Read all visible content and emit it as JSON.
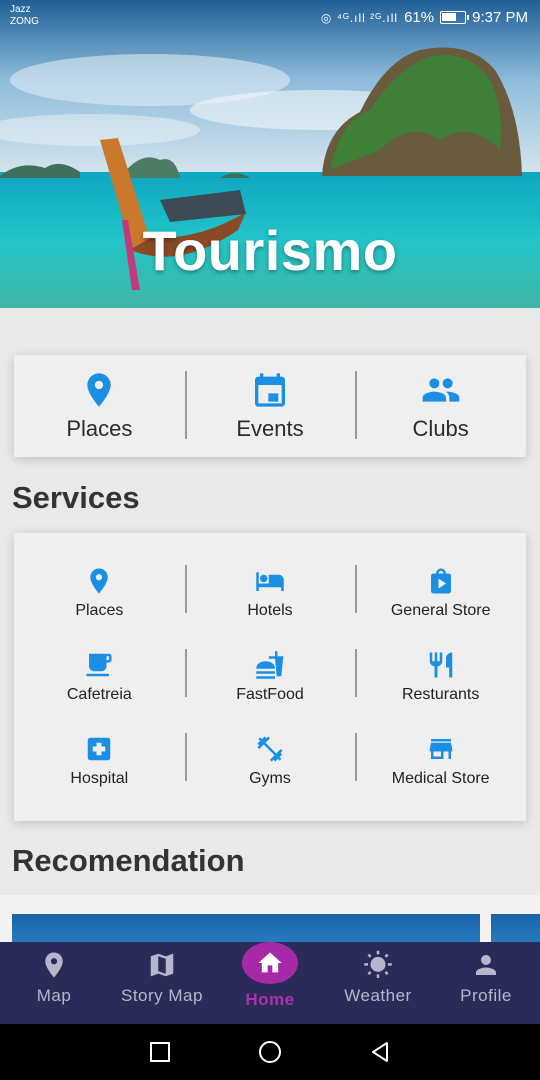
{
  "status_bar": {
    "carrier_1": "Jazz",
    "carrier_2": "ZONG",
    "signal_glyphs": "◎ ⁴ᴳ.ıll ²ᴳ.ıll",
    "battery": "61%",
    "time": "9:37 PM"
  },
  "hero": {
    "title": "Tourismo"
  },
  "quick_links": [
    {
      "label": "Places",
      "icon": "map-pin-icon"
    },
    {
      "label": "Events",
      "icon": "calendar-icon"
    },
    {
      "label": "Clubs",
      "icon": "group-icon"
    }
  ],
  "services": {
    "title": "Services",
    "items": [
      {
        "label": "Places",
        "icon": "map-pin-icon"
      },
      {
        "label": "Hotels",
        "icon": "bed-icon"
      },
      {
        "label": "General Store",
        "icon": "shopping-bag-icon"
      },
      {
        "label": "Cafetreia",
        "icon": "coffee-icon"
      },
      {
        "label": "FastFood",
        "icon": "fastfood-icon"
      },
      {
        "label": "Resturants",
        "icon": "restaurant-icon"
      },
      {
        "label": "Hospital",
        "icon": "hospital-icon"
      },
      {
        "label": "Gyms",
        "icon": "dumbbell-icon"
      },
      {
        "label": "Medical Store",
        "icon": "store-icon"
      }
    ]
  },
  "recommendation": {
    "title": "Recomendation"
  },
  "bottom_nav": [
    {
      "label": "Map",
      "icon": "map-pin-icon",
      "active": false
    },
    {
      "label": "Story Map",
      "icon": "map-icon",
      "active": false
    },
    {
      "label": "Home",
      "icon": "home-icon",
      "active": true
    },
    {
      "label": "Weather",
      "icon": "sun-icon",
      "active": false
    },
    {
      "label": "Profile",
      "icon": "person-icon",
      "active": false
    }
  ],
  "colors": {
    "accent_blue": "#1a8fe3",
    "nav_background": "#2a2b58",
    "home_active": "#a62aa8",
    "nav_inactive": "#b6b7cc"
  }
}
